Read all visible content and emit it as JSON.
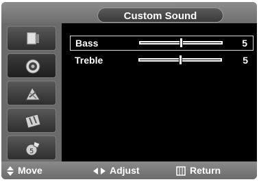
{
  "header": {
    "title": "Custom Sound"
  },
  "sidebar": {
    "items": [
      {
        "name": "Picture",
        "icon": "picture-icon",
        "active": false
      },
      {
        "name": "Sound",
        "icon": "speaker-icon",
        "active": true
      },
      {
        "name": "Channel",
        "icon": "channel-icon",
        "active": false
      },
      {
        "name": "Setup",
        "icon": "setup-icon",
        "active": false
      },
      {
        "name": "Input",
        "icon": "input-icon",
        "active": false
      }
    ]
  },
  "settings": [
    {
      "label": "Bass",
      "value": "5",
      "level": 0.5,
      "selected": true
    },
    {
      "label": "Treble",
      "value": "5",
      "level": 0.5,
      "selected": false
    }
  ],
  "footer": {
    "move": "Move",
    "adjust": "Adjust",
    "return": "Return"
  },
  "colors": {
    "panel": "#b8b8b8",
    "content": "#000000",
    "text": "#ffffff"
  }
}
